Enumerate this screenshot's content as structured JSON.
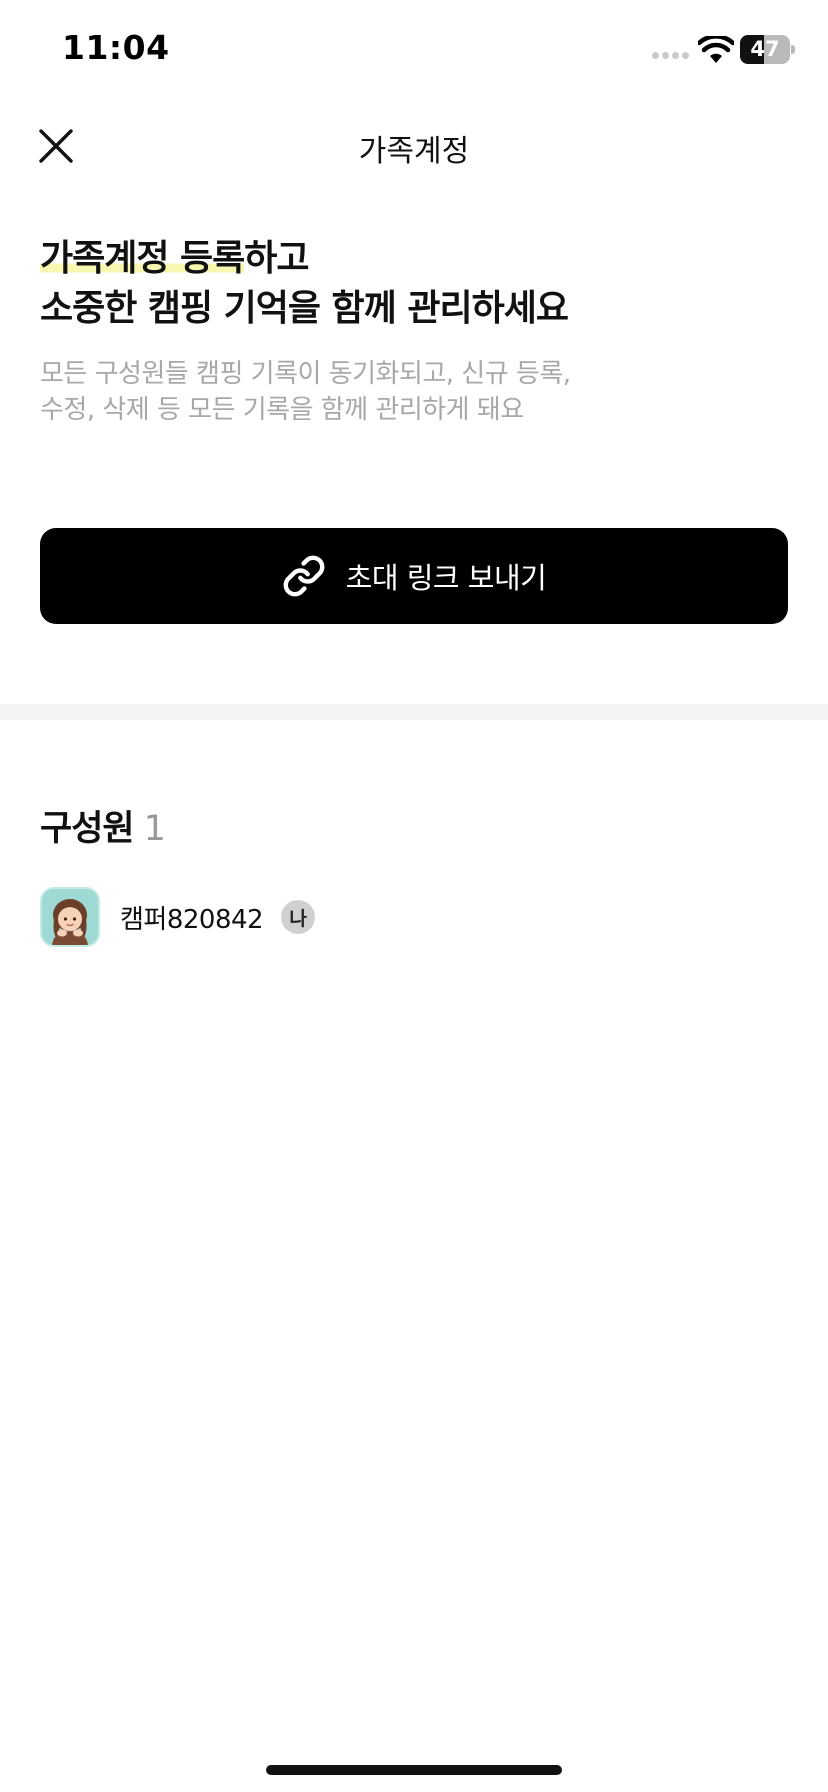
{
  "status_bar": {
    "time": "11:04",
    "battery_level": "47",
    "battery_fraction": 0.47,
    "icons": [
      "cellular-signal-icon",
      "wifi-icon",
      "battery-icon"
    ]
  },
  "header": {
    "title": "가족계정",
    "close_icon": "close-icon"
  },
  "hero": {
    "heading_highlight": "가족계정 등록",
    "heading_rest": "하고",
    "heading_line2": "소중한 캠핑 기억을 함께 관리하세요",
    "description_line1": "모든 구성원들 캠핑 기록이 동기화되고, 신규 등록,",
    "description_line2": "수정, 삭제 등 모든 기록을 함께 관리하게 돼요",
    "highlight_color": "#f8f7b0"
  },
  "invite": {
    "label": "초대 링크 보내기",
    "icon": "link-icon"
  },
  "members": {
    "title": "구성원",
    "count": "1",
    "list": [
      {
        "name": "캠퍼820842",
        "badge": "나",
        "avatar_color": "#9ed9d3"
      }
    ]
  },
  "colors": {
    "primary_button": "#000000",
    "muted_text": "#a8a8a8",
    "divider": "#f4f4f4"
  }
}
